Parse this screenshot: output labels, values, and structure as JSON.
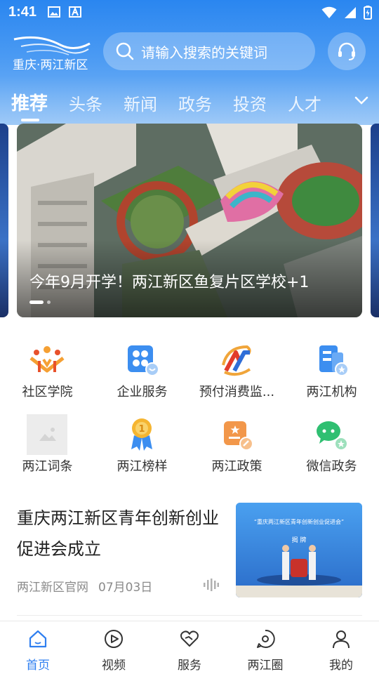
{
  "status_bar": {
    "time": "1:41"
  },
  "header": {
    "logo_text": "重庆·两江新区",
    "search_placeholder": "请输入搜索的关键词",
    "tabs": [
      {
        "label": "推荐",
        "active": true
      },
      {
        "label": "头条"
      },
      {
        "label": "新闻"
      },
      {
        "label": "政务"
      },
      {
        "label": "投资"
      },
      {
        "label": "人才"
      }
    ]
  },
  "banner": {
    "caption": "今年9月开学！两江新区鱼复片区学校+1",
    "active_index": 0,
    "count": 2
  },
  "services": [
    {
      "label": "社区学院",
      "icon": "community-college-icon"
    },
    {
      "label": "企业服务",
      "icon": "enterprise-service-icon"
    },
    {
      "label": "预付消费监...",
      "icon": "prepaid-consumption-icon"
    },
    {
      "label": "两江机构",
      "icon": "liangjiang-institution-icon"
    },
    {
      "label": "两江词条",
      "icon": "image-placeholder-icon"
    },
    {
      "label": "两江榜样",
      "icon": "medal-icon"
    },
    {
      "label": "两江政策",
      "icon": "policy-icon"
    },
    {
      "label": "微信政务",
      "icon": "wechat-icon"
    }
  ],
  "article": {
    "title": "重庆两江新区青年创新创业促进会成立",
    "source": "两江新区官网",
    "date": "07月03日",
    "thumb_banner_text": "“重庆两江新区青年创新创业促进会”",
    "thumb_sign_text": "揭 牌"
  },
  "bottom_nav": [
    {
      "label": "首页",
      "active": true,
      "icon": "home-icon"
    },
    {
      "label": "视频",
      "icon": "video-play-icon"
    },
    {
      "label": "服务",
      "icon": "service-heart-icon"
    },
    {
      "label": "两江圈",
      "icon": "chat-circle-icon"
    },
    {
      "label": "我的",
      "icon": "user-icon"
    }
  ],
  "colors": {
    "brand_blue": "#2a86f0",
    "active_nav": "#2f7ff0"
  }
}
